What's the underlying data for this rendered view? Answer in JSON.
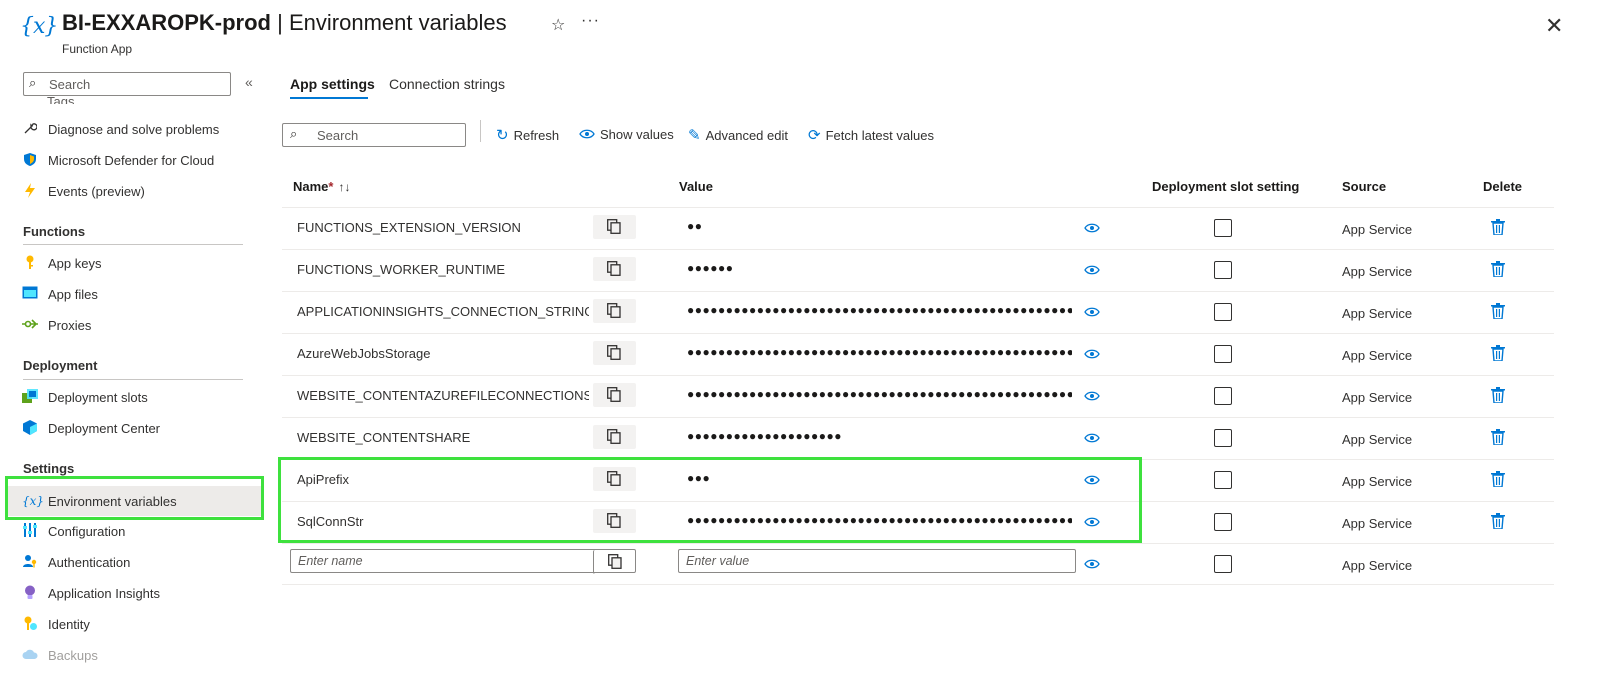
{
  "header": {
    "resource_name": "BI-EXXAROPK-prod",
    "separator": "|",
    "page_title": "Environment variables",
    "subtitle": "Function App",
    "logo_icon": "function-variable-icon",
    "favorite_icon": "☆",
    "more_icon": "···",
    "close_icon": "✕"
  },
  "sidebar": {
    "search_placeholder": "Search",
    "collapse_icon": "«",
    "partial_item": "Tags",
    "items_top": [
      {
        "label": "Diagnose and solve problems",
        "icon": "wrench-icon"
      },
      {
        "label": "Microsoft Defender for Cloud",
        "icon": "shield-icon"
      },
      {
        "label": "Events (preview)",
        "icon": "lightning-icon"
      }
    ],
    "sections": [
      {
        "title": "Functions",
        "items": [
          {
            "label": "App keys",
            "icon": "key-icon"
          },
          {
            "label": "App files",
            "icon": "files-icon"
          },
          {
            "label": "Proxies",
            "icon": "proxy-icon"
          }
        ]
      },
      {
        "title": "Deployment",
        "items": [
          {
            "label": "Deployment slots",
            "icon": "slots-icon"
          },
          {
            "label": "Deployment Center",
            "icon": "cube-icon"
          }
        ]
      },
      {
        "title": "Settings",
        "items": [
          {
            "label": "Environment variables",
            "icon": "function-variable-icon",
            "active": true
          },
          {
            "label": "Configuration",
            "icon": "sliders-icon"
          },
          {
            "label": "Authentication",
            "icon": "user-key-icon"
          },
          {
            "label": "Application Insights",
            "icon": "lightbulb-icon"
          },
          {
            "label": "Identity",
            "icon": "identity-icon"
          },
          {
            "label": "Backups",
            "icon": "cloud-icon",
            "disabled": true
          }
        ]
      }
    ]
  },
  "tabs": [
    {
      "label": "App settings",
      "active": true
    },
    {
      "label": "Connection strings",
      "active": false
    }
  ],
  "toolbar": {
    "search_placeholder": "Search",
    "refresh_label": "Refresh",
    "show_values_label": "Show values",
    "advanced_edit_label": "Advanced edit",
    "fetch_latest_label": "Fetch latest values"
  },
  "grid": {
    "columns": {
      "name": "Name",
      "name_required": "*",
      "name_sort": "↑↓",
      "value": "Value",
      "slot": "Deployment slot setting",
      "source": "Source",
      "delete": "Delete"
    },
    "rows": [
      {
        "name": "FUNCTIONS_EXTENSION_VERSION",
        "value": "●●",
        "source": "App Service",
        "slot_setting": false
      },
      {
        "name": "FUNCTIONS_WORKER_RUNTIME",
        "value": "●●●●●●",
        "source": "App Service",
        "slot_setting": false
      },
      {
        "name": "APPLICATIONINSIGHTS_CONNECTION_STRING",
        "value": "●●●●●●●●●●●●●●●●●●●●●●●●●●●●●●●●●●●●●●●●●●●●●●●●●● ...",
        "source": "App Service",
        "slot_setting": false
      },
      {
        "name": "AzureWebJobsStorage",
        "value": "●●●●●●●●●●●●●●●●●●●●●●●●●●●●●●●●●●●●●●●●●●●●●●●●●● ...",
        "source": "App Service",
        "slot_setting": false
      },
      {
        "name": "WEBSITE_CONTENTAZUREFILECONNECTIONSTRI ...",
        "value": "●●●●●●●●●●●●●●●●●●●●●●●●●●●●●●●●●●●●●●●●●●●●●●●●●● ...",
        "source": "App Service",
        "slot_setting": false
      },
      {
        "name": "WEBSITE_CONTENTSHARE",
        "value": "●●●●●●●●●●●●●●●●●●●●",
        "source": "App Service",
        "slot_setting": false
      },
      {
        "name": "ApiPrefix",
        "value": "●●●",
        "source": "App Service",
        "slot_setting": false
      },
      {
        "name": "SqlConnStr",
        "value": "●●●●●●●●●●●●●●●●●●●●●●●●●●●●●●●●●●●●●●●●●●●●●●●●●● ...",
        "source": "App Service",
        "slot_setting": false
      }
    ],
    "new_row": {
      "name_placeholder": "Enter name",
      "value_placeholder": "Enter value",
      "source": "App Service"
    }
  },
  "colors": {
    "accent": "#0078d4",
    "highlight_box": "#3ee13e",
    "required": "#a4262c"
  }
}
